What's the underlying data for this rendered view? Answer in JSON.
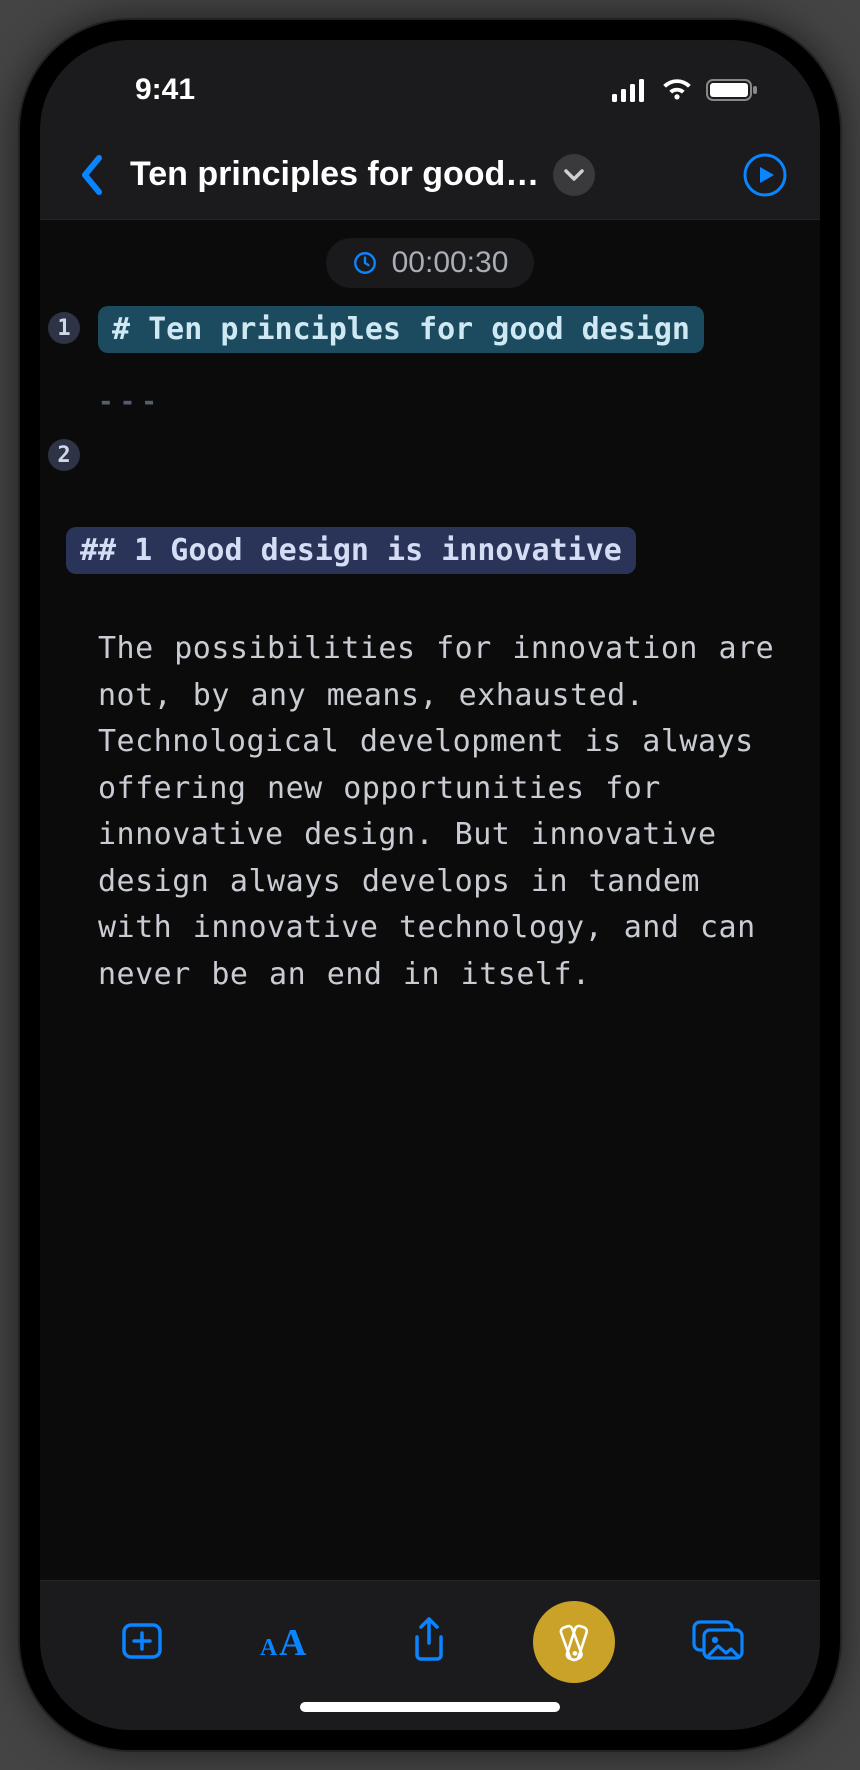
{
  "status": {
    "time": "9:41"
  },
  "header": {
    "title": "Ten principles for good…"
  },
  "timer": {
    "value": "00:00:30"
  },
  "editor": {
    "lines": {
      "h1_num": "1",
      "h1_text": "# Ten principles for good design",
      "hr": "---",
      "h2_num": "2",
      "h2_text": "## 1 Good design is innovative",
      "body": "The possibilities for innovation are not, by any means, exhausted. Technological development is always offering new opportunities for innovative design. But innovative design always develops in tandem with innovative technology, and can never be an end in itself."
    }
  },
  "toolbar": {
    "add": "add",
    "font": "font",
    "share": "share",
    "theme": "theme",
    "image": "image"
  }
}
